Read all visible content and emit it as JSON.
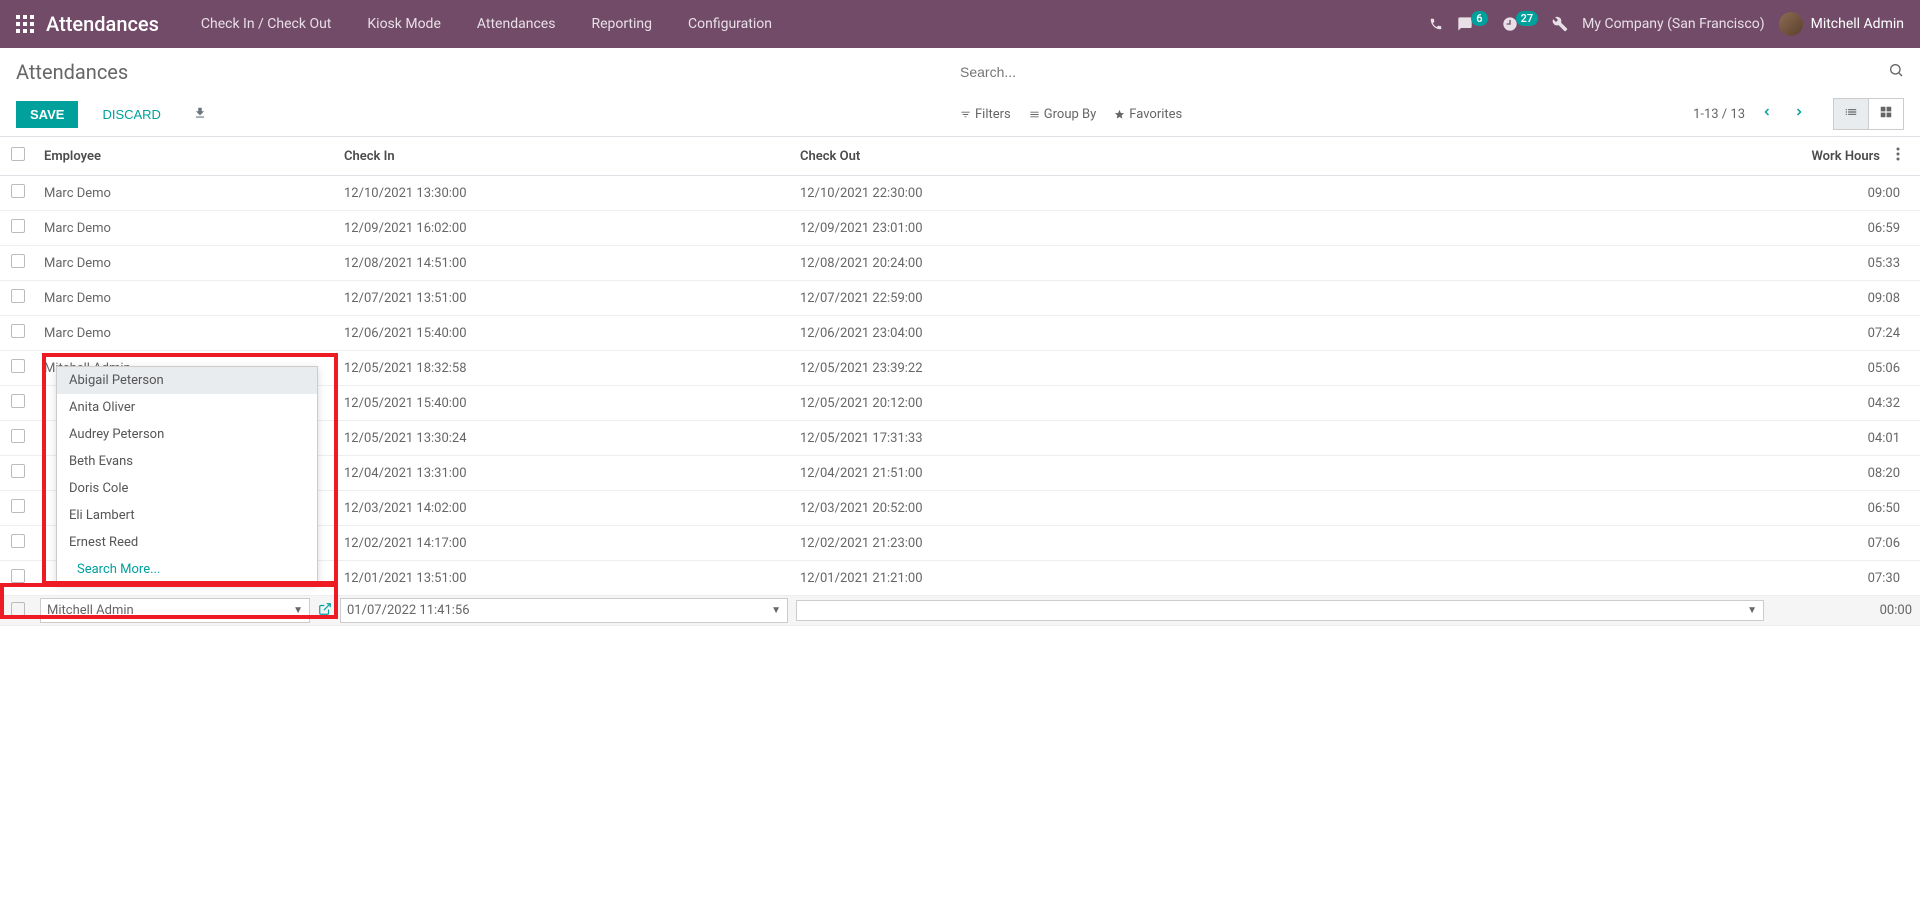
{
  "navbar": {
    "brand": "Attendances",
    "menu": [
      {
        "label": "Check In / Check Out"
      },
      {
        "label": "Kiosk Mode"
      },
      {
        "label": "Attendances"
      },
      {
        "label": "Reporting"
      },
      {
        "label": "Configuration"
      }
    ],
    "messages_badge": "6",
    "activities_badge": "27",
    "company": "My Company (San Francisco)",
    "user": "Mitchell Admin"
  },
  "control_panel": {
    "title": "Attendances",
    "search_placeholder": "Search...",
    "save_label": "SAVE",
    "discard_label": "DISCARD",
    "filters_label": "Filters",
    "groupby_label": "Group By",
    "favorites_label": "Favorites",
    "pager": "1-13 / 13"
  },
  "table": {
    "headers": {
      "employee": "Employee",
      "checkin": "Check In",
      "checkout": "Check Out",
      "work_hours": "Work Hours"
    },
    "rows": [
      {
        "employee": "Marc Demo",
        "checkin": "12/10/2021 13:30:00",
        "checkout": "12/10/2021 22:30:00",
        "hours": "09:00"
      },
      {
        "employee": "Marc Demo",
        "checkin": "12/09/2021 16:02:00",
        "checkout": "12/09/2021 23:01:00",
        "hours": "06:59"
      },
      {
        "employee": "Marc Demo",
        "checkin": "12/08/2021 14:51:00",
        "checkout": "12/08/2021 20:24:00",
        "hours": "05:33"
      },
      {
        "employee": "Marc Demo",
        "checkin": "12/07/2021 13:51:00",
        "checkout": "12/07/2021 22:59:00",
        "hours": "09:08"
      },
      {
        "employee": "Marc Demo",
        "checkin": "12/06/2021 15:40:00",
        "checkout": "12/06/2021 23:04:00",
        "hours": "07:24"
      },
      {
        "employee": "Mitchell Admin",
        "checkin": "12/05/2021 18:32:58",
        "checkout": "12/05/2021 23:39:22",
        "hours": "05:06"
      },
      {
        "employee": "",
        "checkin": "12/05/2021 15:40:00",
        "checkout": "12/05/2021 20:12:00",
        "hours": "04:32"
      },
      {
        "employee": "",
        "checkin": "12/05/2021 13:30:24",
        "checkout": "12/05/2021 17:31:33",
        "hours": "04:01"
      },
      {
        "employee": "",
        "checkin": "12/04/2021 13:31:00",
        "checkout": "12/04/2021 21:51:00",
        "hours": "08:20"
      },
      {
        "employee": "",
        "checkin": "12/03/2021 14:02:00",
        "checkout": "12/03/2021 20:52:00",
        "hours": "06:50"
      },
      {
        "employee": "",
        "checkin": "12/02/2021 14:17:00",
        "checkout": "12/02/2021 21:23:00",
        "hours": "07:06"
      },
      {
        "employee": "",
        "checkin": "12/01/2021 13:51:00",
        "checkout": "12/01/2021 21:21:00",
        "hours": "07:30"
      }
    ],
    "edit_row": {
      "employee": "Mitchell Admin",
      "checkin": "01/07/2022 11:41:56",
      "checkout": "",
      "hours": "00:00"
    }
  },
  "dropdown": {
    "options": [
      "Abigail Peterson",
      "Anita Oliver",
      "Audrey Peterson",
      "Beth Evans",
      "Doris Cole",
      "Eli Lambert",
      "Ernest Reed"
    ],
    "search_more": "Search More..."
  }
}
